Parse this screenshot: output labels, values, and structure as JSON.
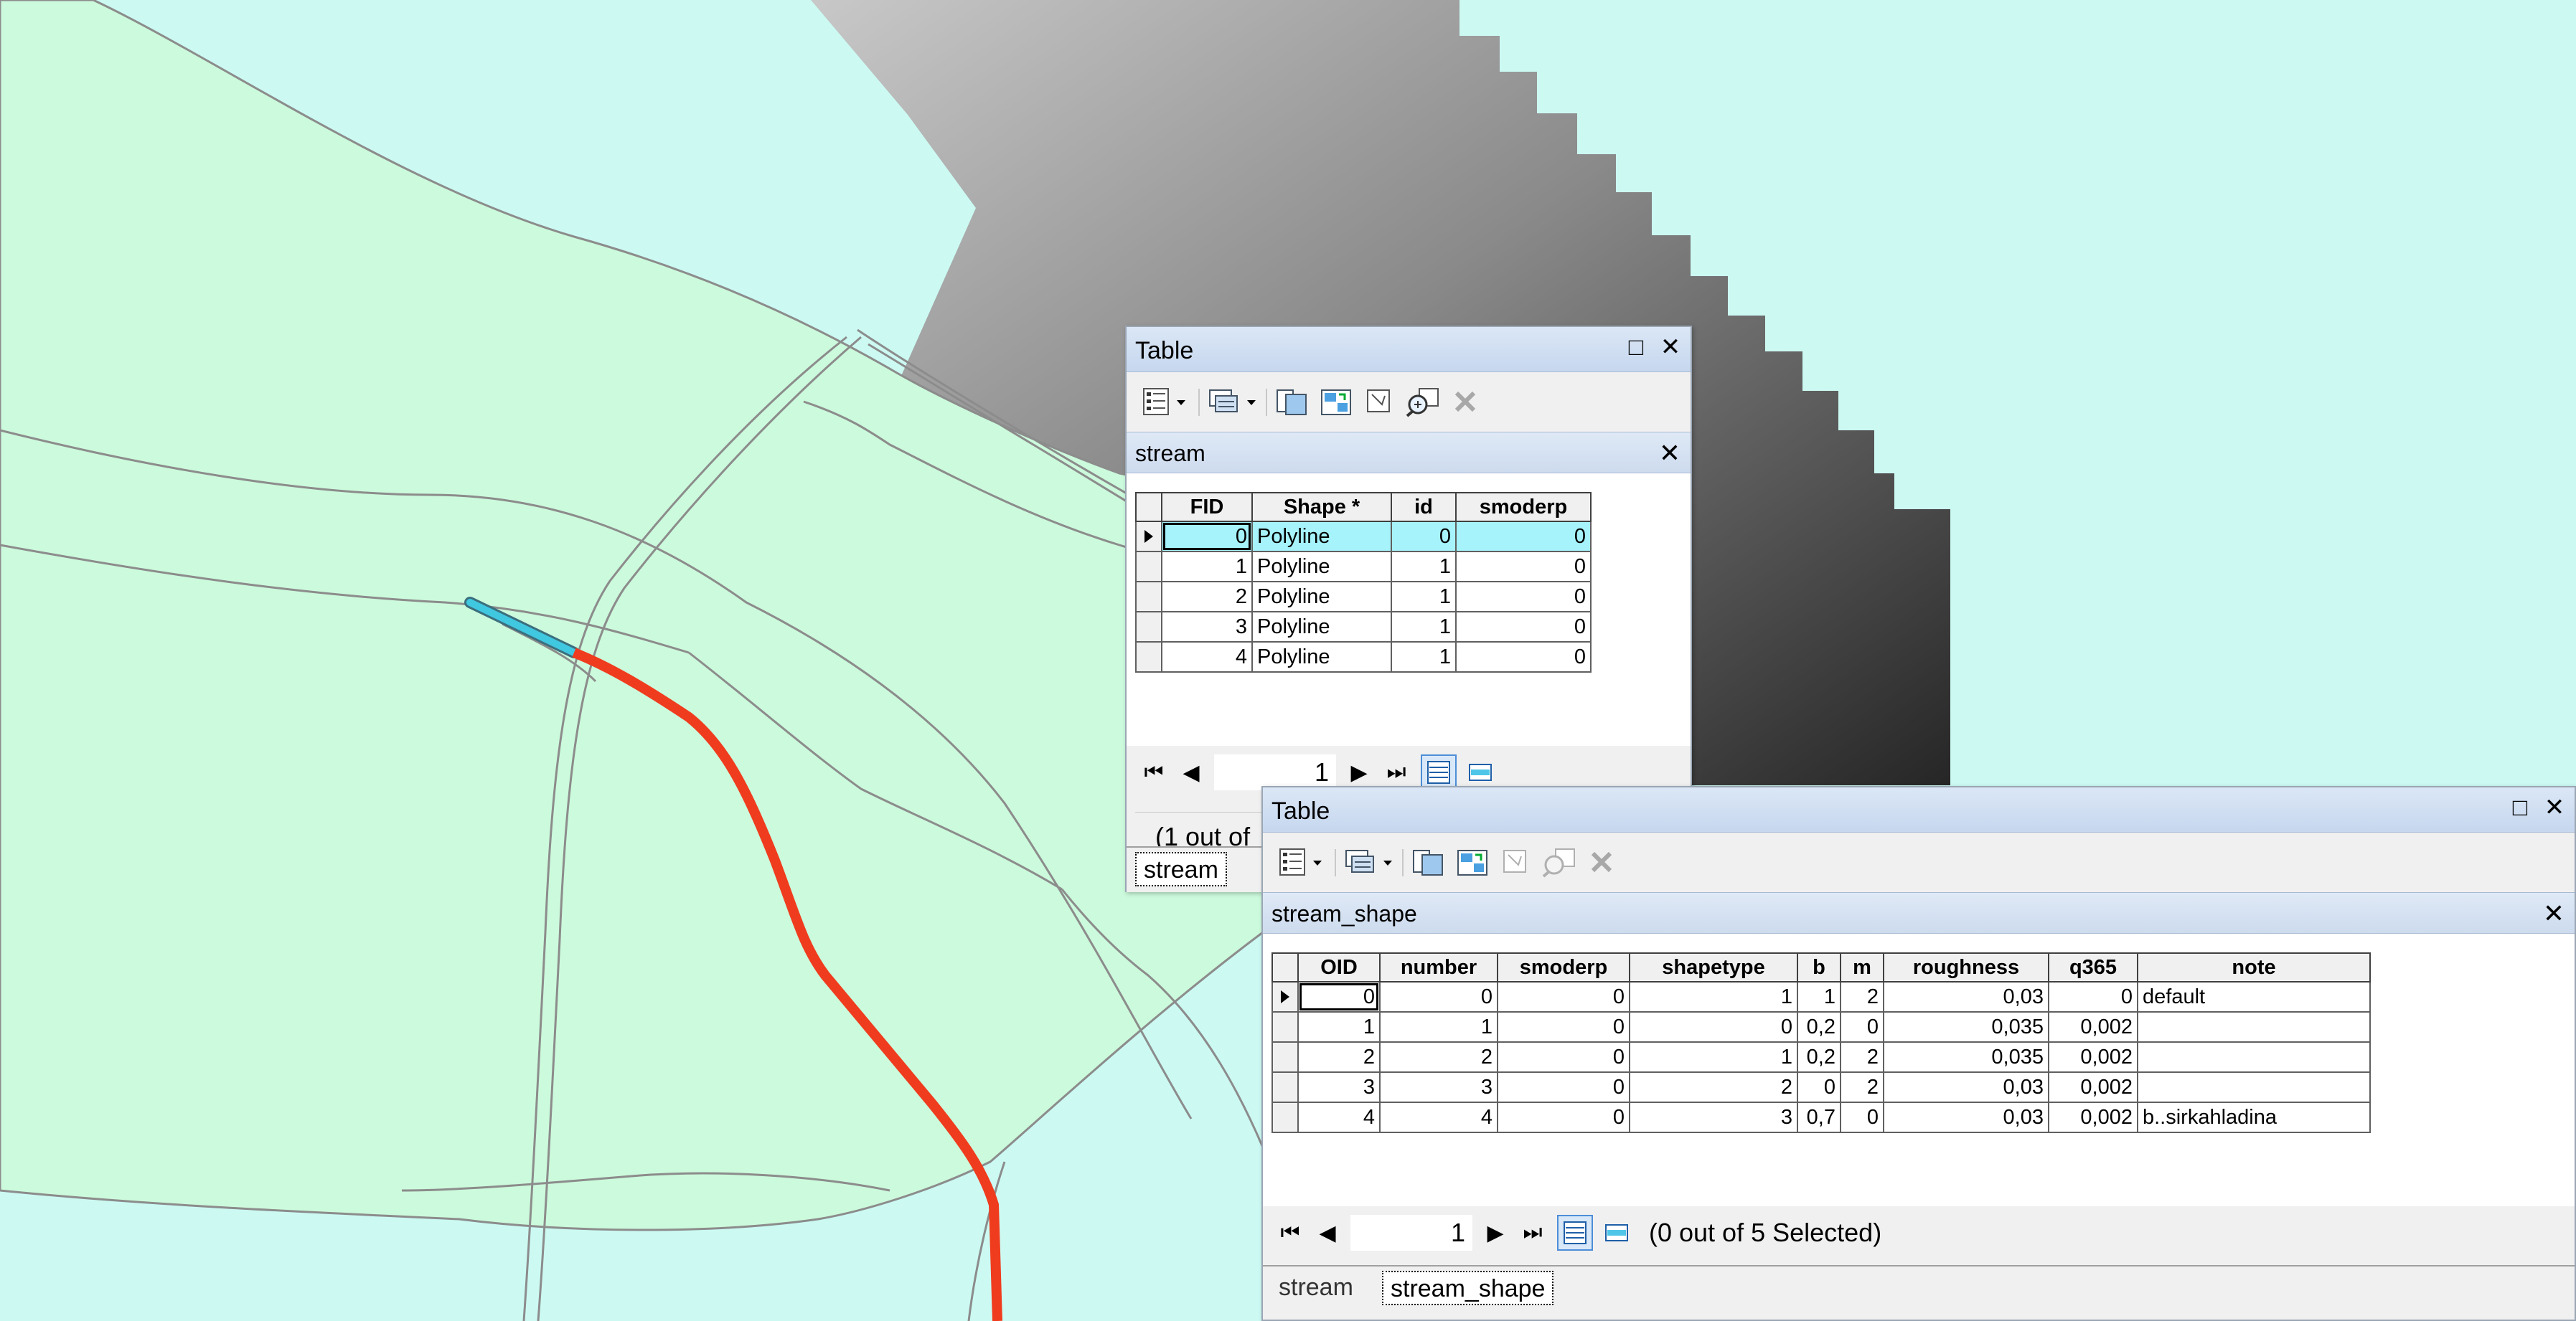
{
  "colors": {
    "basin_fill": "#ccfadc",
    "water_fill": "#ccfaf3",
    "stream_line": "#f03c1e",
    "selected_segment": "#40c8e0",
    "selected_row": "#a6f3fb"
  },
  "window1": {
    "title": "Table",
    "layer_tab": "stream",
    "columns": [
      "FID",
      "Shape *",
      "id",
      "smoderp"
    ],
    "rows": [
      [
        "0",
        "Polyline",
        "0",
        "0"
      ],
      [
        "1",
        "Polyline",
        "1",
        "0"
      ],
      [
        "2",
        "Polyline",
        "1",
        "0"
      ],
      [
        "3",
        "Polyline",
        "1",
        "0"
      ],
      [
        "4",
        "Polyline",
        "1",
        "0"
      ]
    ],
    "page": "1",
    "status": "(1 out of",
    "bottom_tabs": [
      "stream"
    ]
  },
  "window2": {
    "title": "Table",
    "layer_tab": "stream_shape",
    "columns": [
      "OID",
      "number",
      "smoderp",
      "shapetype",
      "b",
      "m",
      "roughness",
      "q365",
      "note"
    ],
    "rows": [
      [
        "0",
        "0",
        "0",
        "1",
        "1",
        "2",
        "0,03",
        "0",
        "default"
      ],
      [
        "1",
        "1",
        "0",
        "0",
        "0,2",
        "0",
        "0,035",
        "0,002",
        ""
      ],
      [
        "2",
        "2",
        "0",
        "1",
        "0,2",
        "2",
        "0,035",
        "0,002",
        ""
      ],
      [
        "3",
        "3",
        "0",
        "2",
        "0",
        "2",
        "0,03",
        "0,002",
        ""
      ],
      [
        "4",
        "4",
        "0",
        "3",
        "0,7",
        "0",
        "0,03",
        "0,002",
        "b..sirkahladina"
      ]
    ],
    "page": "1",
    "status": "(0 out of 5 Selected)",
    "bottom_tabs": [
      "stream",
      "stream_shape"
    ]
  }
}
